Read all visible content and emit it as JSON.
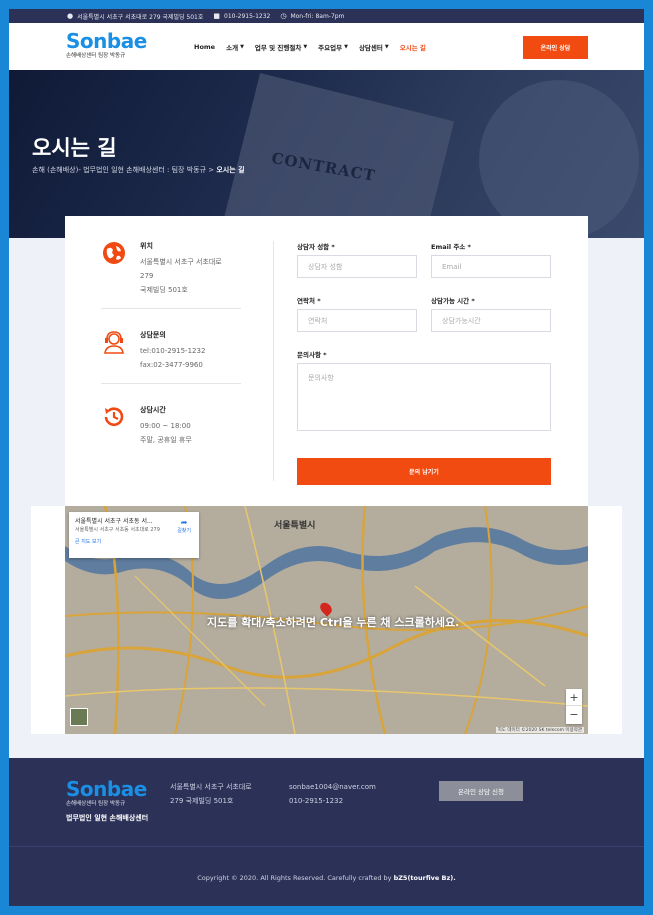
{
  "topbar": {
    "address": "서울특별시 서초구 서초대로 279 국제빌딩 501호",
    "phone": "010-2915-1232",
    "hours": "Mon-fri: 8am-7pm"
  },
  "logo": {
    "word": "Sonbae",
    "sub": "손해배상센터 팀장 박동규"
  },
  "nav": {
    "items": [
      {
        "label": "Home",
        "has_caret": false
      },
      {
        "label": "소개",
        "has_caret": true
      },
      {
        "label": "업무 및 진행절차",
        "has_caret": true
      },
      {
        "label": "주요업무",
        "has_caret": true
      },
      {
        "label": "상담센터",
        "has_caret": true
      },
      {
        "label": "오시는 길",
        "has_caret": false,
        "active": true
      }
    ],
    "cta": "온라인 상담"
  },
  "hero": {
    "title": "오시는 길",
    "crumb_path": "손해 (손해배상)- 법무법인 일현 손해배상센터 : 팀장 박동규 > ",
    "crumb_current": "오시는 길",
    "image_text": "CONTRACT"
  },
  "info": [
    {
      "icon": "globe-icon",
      "title": "위치",
      "lines": [
        "서울특별시 서초구 서초대로",
        "279",
        "국제빌딩 501호"
      ]
    },
    {
      "icon": "consultant-icon",
      "title": "상담문의",
      "lines": [
        "tel:010-2915-1232",
        "fax:02-3477-9960"
      ]
    },
    {
      "icon": "clock-icon",
      "title": "상담시간",
      "lines": [
        "09:00 ~ 18:00",
        "주말, 공휴일 휴무"
      ]
    }
  ],
  "form": {
    "name_label": "상담자 성함 *",
    "name_placeholder": "상담자 성함",
    "email_label": "Email 주소 *",
    "email_placeholder": "Email",
    "phone_label": "연락처 *",
    "phone_placeholder": "연락처",
    "time_label": "상담가능 시간 *",
    "time_placeholder": "상담가능시간",
    "message_label": "문의사항 *",
    "message_placeholder": "문의사항",
    "submit": "문의 남기기"
  },
  "map": {
    "card_title": "서울특별시 서초구 서초동 서...",
    "card_addr": "서울특별시 서초구 서초동 서초대로 279",
    "card_link": "큰 지도 보기",
    "directions": "길찾기",
    "city_label": "서울특별시",
    "overlay": "지도를 확대/축소하려면 Ctrl을 누른 채 스크롤하세요.",
    "attribution": "지도 데이터 ©2020 SK telecom  이용약관",
    "zoom_in": "+",
    "zoom_out": "−"
  },
  "footer": {
    "firm": "법무법인 일현 손해배상센터",
    "address1": "서울특별시 서초구 서초대로",
    "address2": "279 국제빌딩 501호",
    "email": "sonbae1004@naver.com",
    "phone": "010-2915-1232",
    "button": "온라인 상담 신청",
    "copyright_text": "Copyright © 2020. All Rights Reserved. Carefully crafted by ",
    "copyright_brand": "bZ5(tourfive Bz)."
  },
  "colors": {
    "accent": "#f24b12",
    "brand_blue": "#1a8fe3",
    "navy": "#2c3158"
  }
}
